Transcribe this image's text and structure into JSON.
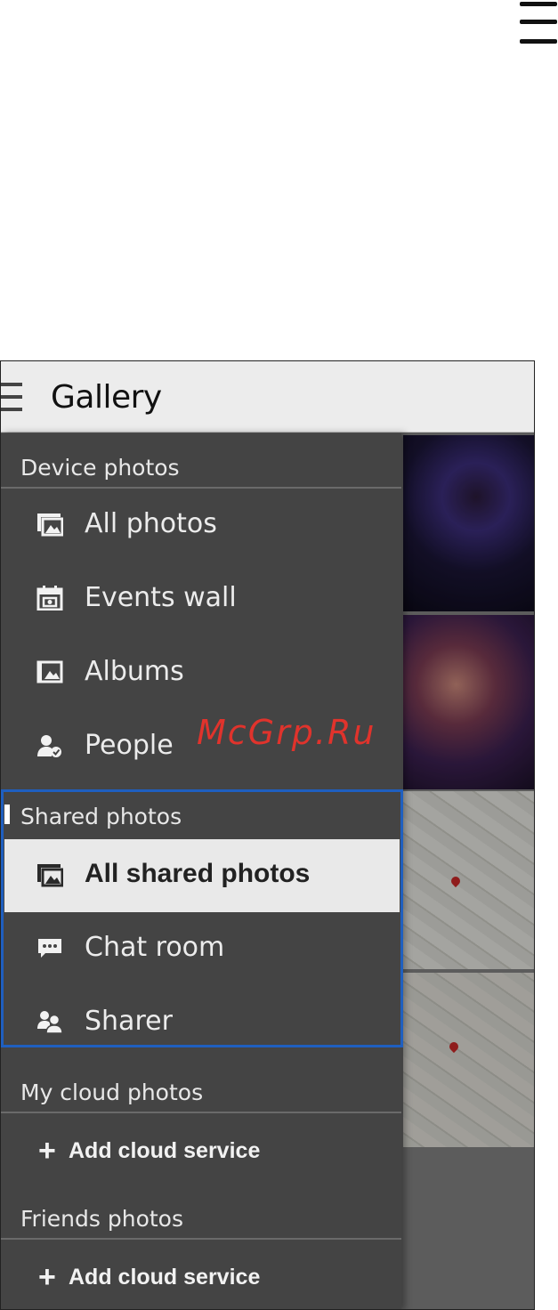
{
  "app": {
    "title": "Gallery"
  },
  "watermark": "McGrp.Ru",
  "drawer": {
    "device_section": "Device photos",
    "device_items": [
      {
        "label": "All photos",
        "icon": "photos-icon"
      },
      {
        "label": "Events wall",
        "icon": "events-calendar-icon"
      },
      {
        "label": "Albums",
        "icon": "album-icon"
      },
      {
        "label": "People",
        "icon": "person-check-icon"
      }
    ],
    "shared_section": "Shared photos",
    "shared_items": [
      {
        "label": "All shared photos",
        "icon": "photos-icon",
        "selected": true
      },
      {
        "label": "Chat room",
        "icon": "chat-bubble-icon"
      },
      {
        "label": "Sharer",
        "icon": "people-icon"
      }
    ],
    "cloud_section": "My cloud photos",
    "cloud_add": "Add cloud service",
    "friends_section": "Friends photos",
    "friends_add": "Add cloud service"
  },
  "colors": {
    "drawer_bg": "#444444",
    "selected_bg": "#e9e9e9",
    "highlight": "#1f5fbf",
    "watermark": "#e0332c"
  }
}
